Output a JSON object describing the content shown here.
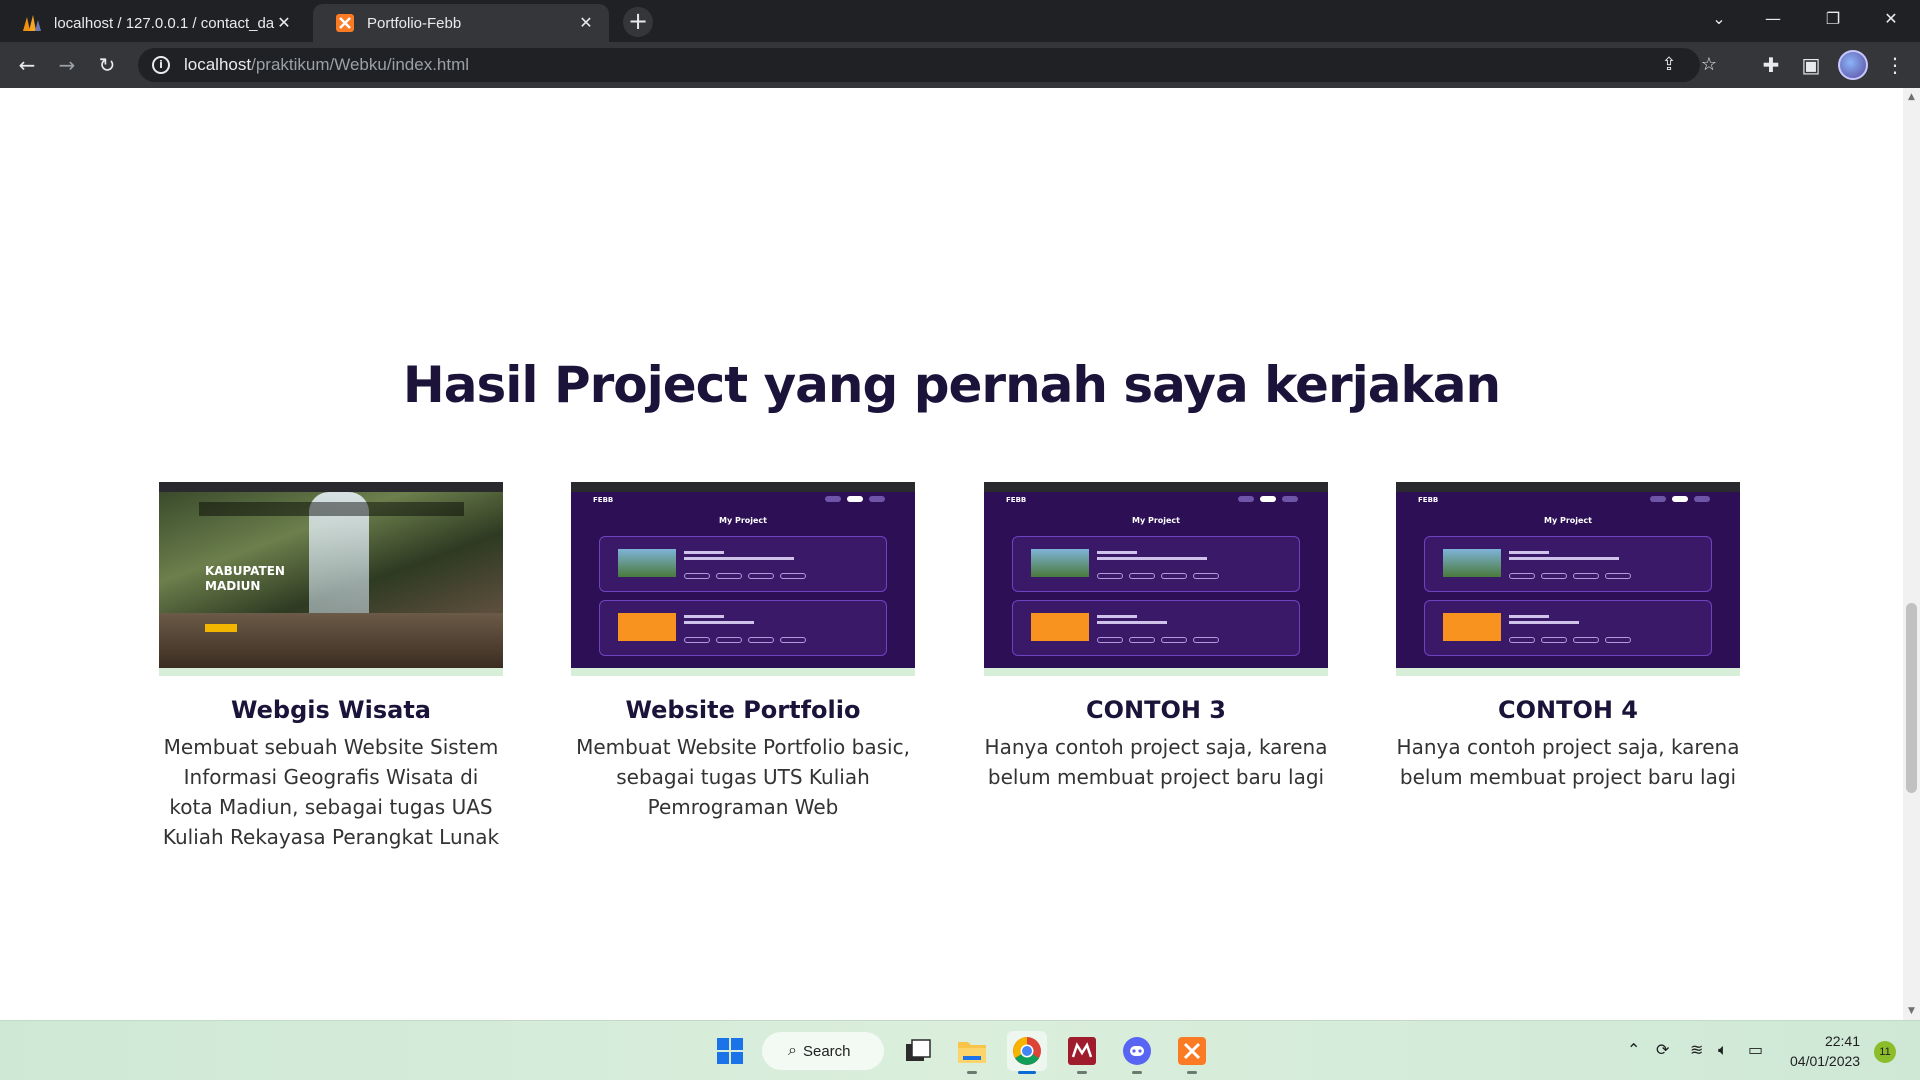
{
  "browser": {
    "tabs": [
      {
        "title": "localhost / 127.0.0.1 / contact_da",
        "icon": "phpmyadmin-icon",
        "active": false
      },
      {
        "title": "Portfolio-Febb",
        "icon": "xampp-icon",
        "active": true
      }
    ],
    "url": {
      "host": "localhost",
      "path": "/praktikum/Webku/index.html"
    }
  },
  "page": {
    "section_title": "Hasil Project yang pernah saya kerjakan",
    "projects": [
      {
        "name": "Webgis Wisata",
        "description": "Membuat sebuah Website Sistem Informasi Geografis Wisata di kota Madiun, sebagai tugas UAS Kuliah Rekayasa Perangkat Lunak",
        "thumbnail_text": "KABUPATEN MADIUN"
      },
      {
        "name": "Website Portfolio",
        "description": "Membuat Website Portfolio basic, sebagai tugas UTS Kuliah Pemrograman Web",
        "thumbnail_text": "My Project"
      },
      {
        "name": "CONTOH 3",
        "description": "Hanya contoh project saja, karena belum membuat project baru lagi",
        "thumbnail_text": "My Project"
      },
      {
        "name": "CONTOH 4",
        "description": "Hanya contoh project saja, karena belum membuat project baru lagi",
        "thumbnail_text": "My Project"
      }
    ]
  },
  "taskbar": {
    "search_label": "Search",
    "apps": [
      "file-explorer-icon",
      "folder-icon",
      "chrome-icon",
      "mendeley-icon",
      "discord-icon",
      "xampp-icon"
    ],
    "time": "22:41",
    "date": "04/01/2023",
    "notification_count": "11"
  },
  "colors": {
    "heading": "#1b1339",
    "portfolio_bg": "#2c0f55",
    "chrome_dark": "#202124"
  }
}
